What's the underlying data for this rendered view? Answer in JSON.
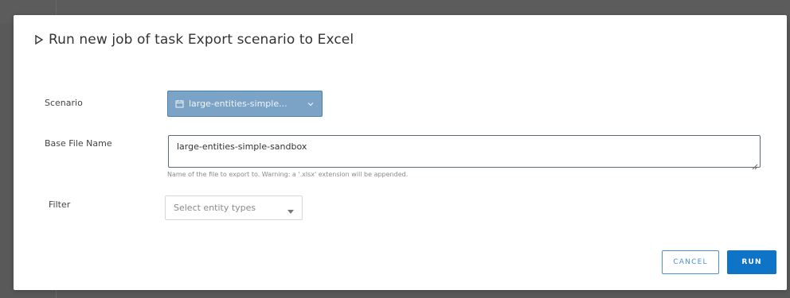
{
  "dialog": {
    "title": "Run new job of task Export scenario to Excel",
    "title_icon": "play-icon"
  },
  "fields": {
    "scenario": {
      "label": "Scenario",
      "value": "large-entities-simple...",
      "icon": "calendar-icon"
    },
    "base_file_name": {
      "label": "Base File Name",
      "value": "large-entities-simple-sandbox",
      "helper": "Name of the file to export to. Warning: a '.xlsx' extension will be appended."
    },
    "filter": {
      "label": "Filter",
      "placeholder": "Select entity types"
    }
  },
  "actions": {
    "cancel_label": "CANCEL",
    "run_label": "RUN"
  },
  "colors": {
    "overlay": "#5b5b5b",
    "dialog_bg": "#ffffff",
    "scenario_bg": "#7aa3c6",
    "cancel_border": "#4b91cf",
    "run_bg": "#0d74c8"
  }
}
